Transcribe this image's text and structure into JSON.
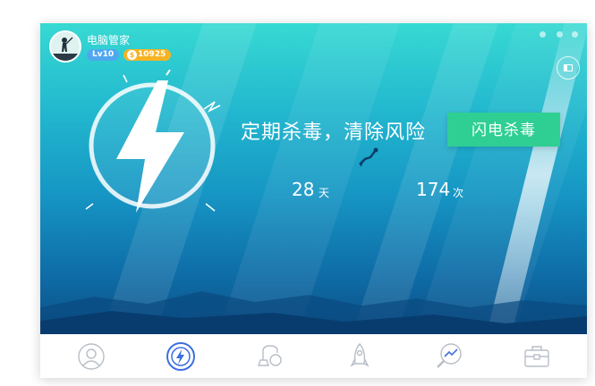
{
  "header": {
    "title": "电脑管家",
    "level_badge": "Lv10",
    "coins_symbol": "$",
    "coins": "10925"
  },
  "hero": {
    "headline": "定期杀毒，清除风险",
    "cta_label": "闪电杀毒",
    "stats": [
      {
        "value": "28",
        "unit": "天"
      },
      {
        "value": "174",
        "unit": "次"
      }
    ]
  },
  "bottom_nav": [
    {
      "icon": "user-profile-icon"
    },
    {
      "icon": "lightning-scan-icon",
      "active": true
    },
    {
      "icon": "vacuum-cleaner-icon"
    },
    {
      "icon": "rocket-icon"
    },
    {
      "icon": "magnifier-trend-icon"
    },
    {
      "icon": "toolbox-icon"
    }
  ],
  "colors": {
    "accent_green": "#2fcf94",
    "coin_orange": "#f5b323",
    "level_blue": "#4fa8ef",
    "active_nav_blue": "#3d6fe0",
    "nav_gray": "#b8bec7"
  }
}
